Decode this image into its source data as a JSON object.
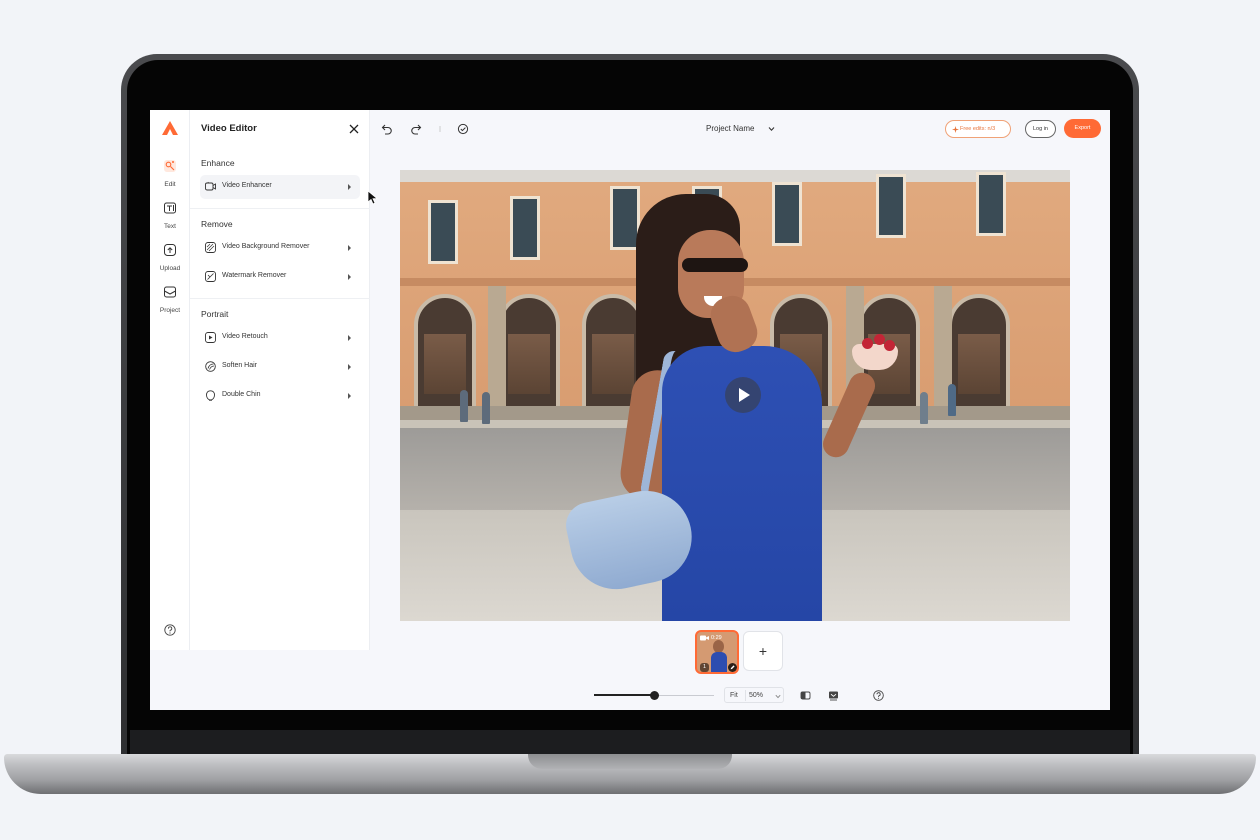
{
  "colors": {
    "accent": "#ff6a35",
    "free_border": "#f0a277",
    "free_text": "#e8743b"
  },
  "rail": {
    "items": [
      {
        "label": "Edit",
        "icon": "edit-icon"
      },
      {
        "label": "Text",
        "icon": "text-icon"
      },
      {
        "label": "Upload",
        "icon": "upload-icon"
      },
      {
        "label": "Project",
        "icon": "project-icon"
      }
    ],
    "help_icon": "help-icon"
  },
  "panel": {
    "title": "Video Editor",
    "sections": [
      {
        "label": "Enhance",
        "tools": [
          {
            "label": "Video Enhancer",
            "icon": "video-enhancer-icon"
          }
        ]
      },
      {
        "label": "Remove",
        "tools": [
          {
            "label": "Video Background Remover",
            "icon": "background-remover-icon"
          },
          {
            "label": "Watermark Remover",
            "icon": "watermark-remover-icon"
          }
        ]
      },
      {
        "label": "Portrait",
        "tools": [
          {
            "label": "Video Retouch",
            "icon": "retouch-icon"
          },
          {
            "label": "Soften Hair",
            "icon": "soften-hair-icon"
          },
          {
            "label": "Double Chin",
            "icon": "double-chin-icon"
          }
        ]
      }
    ]
  },
  "topbar": {
    "project_name": "Project Name",
    "free_edits": "Free edits: n/3",
    "login": "Log in",
    "export": "Export"
  },
  "timeline": {
    "clip_duration": "0:29",
    "clip_index": "1",
    "add_label": "+"
  },
  "bottombar": {
    "fit": "Fit",
    "zoom": "50%",
    "zoom_level": 0.5
  }
}
